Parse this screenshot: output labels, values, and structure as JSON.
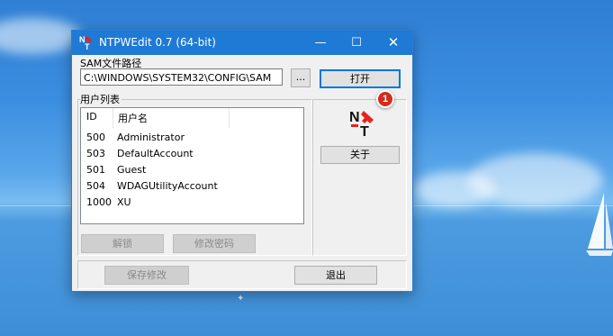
{
  "window": {
    "title": "NTPWEdit 0.7 (64-bit)",
    "controls": {
      "minimize": "—",
      "maximize": "☐",
      "close": "✕"
    }
  },
  "sam": {
    "label": "SAM文件路径",
    "path_value": "C:\\WINDOWS\\SYSTEM32\\CONFIG\\SAM",
    "browse_label": "...",
    "open_label": "打开"
  },
  "users": {
    "label": "用户列表",
    "columns": [
      "ID",
      "用户名"
    ],
    "rows": [
      {
        "id": "500",
        "name": "Administrator"
      },
      {
        "id": "503",
        "name": "DefaultAccount"
      },
      {
        "id": "501",
        "name": "Guest"
      },
      {
        "id": "504",
        "name": "WDAGUtilityAccount"
      },
      {
        "id": "1000",
        "name": "XU"
      }
    ]
  },
  "actions": {
    "unlock_label": "解锁",
    "change_password_label": "修改密码",
    "about_label": "关于",
    "save_label": "保存修改",
    "exit_label": "退出"
  },
  "annotation": {
    "badge": "1"
  },
  "colors": {
    "titlebar": "#1e7ad4",
    "badge": "#d42b1e",
    "logo_red": "#e8231c"
  }
}
